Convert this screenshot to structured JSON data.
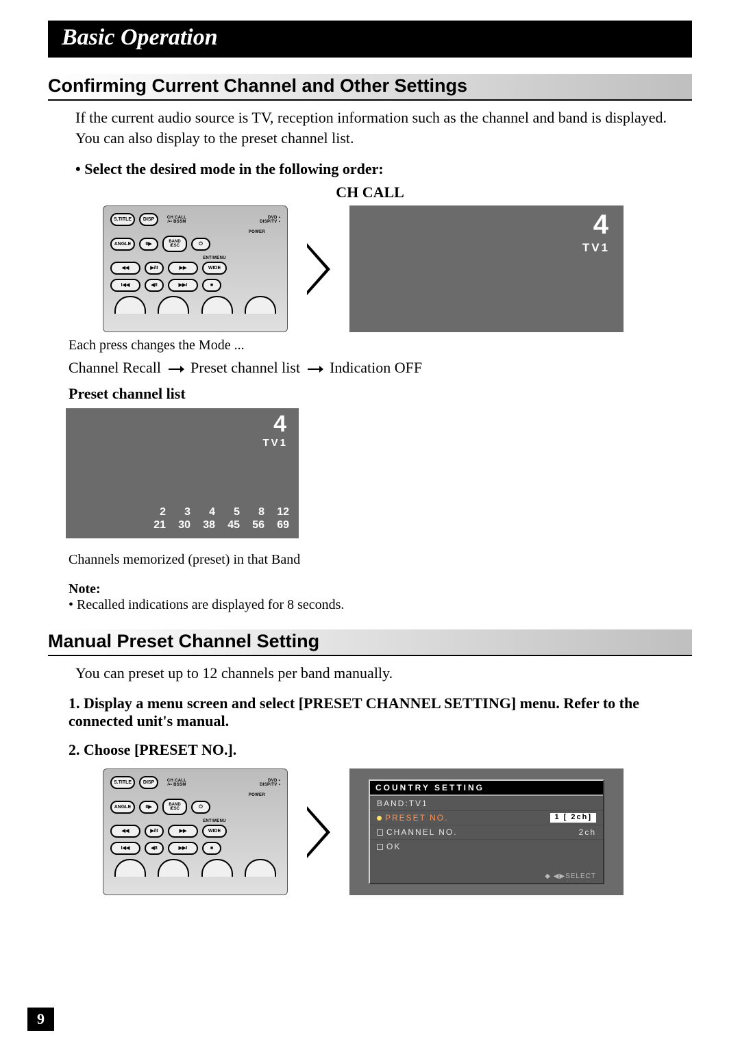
{
  "banner": "Basic Operation",
  "section1": {
    "title": "Confirming Current Channel and Other Settings",
    "intro": "If the current audio source is TV, reception information such as the channel and band is displayed. You can also display to the preset channel list.",
    "bullet": "• Select the desired mode in the following order:",
    "ch_call": "CH CALL",
    "mode_caption": "Each press changes the Mode ...",
    "seq_a": "Channel Recall",
    "seq_b": "Preset channel list",
    "seq_c": "Indication OFF",
    "preset_head": "Preset channel list",
    "preset_caption": "Channels memorized (preset) in that Band",
    "note_label": "Note:",
    "note_item": "• Recalled indications are displayed for 8 seconds."
  },
  "display": {
    "channel": "4",
    "band": "TV1",
    "preset_row1": [
      "2",
      "3",
      "4",
      "5",
      "8",
      "12"
    ],
    "preset_row2": [
      "21",
      "30",
      "38",
      "45",
      "56",
      "69"
    ]
  },
  "remote": {
    "s_title": "S.TITLE",
    "disp": "DISP",
    "ch_call": "CH CALL",
    "bssm": "/•• BSSM",
    "dvd": "DVD",
    "disp_tv": "DISP/TV",
    "power": "POWER",
    "angle": "ANGLE",
    "pause": "II▶",
    "band_esc": "BAND\n/ESC",
    "ent_menu": "ENT/MENU",
    "rew": "◀◀",
    "playpause": "▶/II",
    "ff": "▶▶",
    "wide": "WIDE",
    "prev": "I◀◀",
    "left_step": "◀II",
    "next": "▶▶I",
    "stop": "■"
  },
  "section2": {
    "title": "Manual Preset Channel Setting",
    "intro": "You can preset up to 12 channels per band manually.",
    "step1": "1.  Display a menu screen and select [PRESET CHANNEL SETTING] menu. Refer to the connected unit's manual.",
    "step2": "2.  Choose [PRESET NO.]."
  },
  "menu": {
    "title": "COUNTRY SETTING",
    "row_band_k": "BAND:",
    "row_band_v": "TV1",
    "row_preset_k": "PRESET NO.",
    "row_preset_v": "1 [ 2ch]",
    "row_ch_k": "CHANNEL NO.",
    "row_ch_v": "2ch",
    "row_ok": "OK",
    "foot": "◆ ◀▶SELECT"
  },
  "page_number": "9"
}
